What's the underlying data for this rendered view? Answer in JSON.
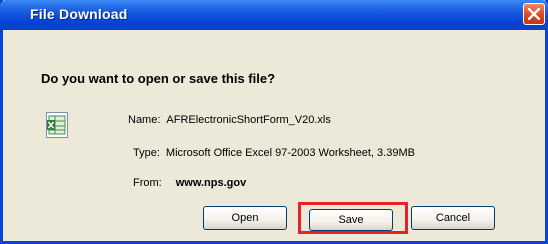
{
  "window": {
    "title": "File Download"
  },
  "dialog": {
    "question": "Do you want to open or save this file?",
    "file": {
      "name_label": "Name:",
      "name_value": "AFRElectronicShortForm_V20.xls",
      "type_label": "Type:",
      "type_value": "Microsoft Office Excel 97-2003 Worksheet, 3.39MB",
      "from_label": "From:",
      "from_value": "www.nps.gov"
    }
  },
  "buttons": {
    "open": "Open",
    "save": "Save",
    "cancel": "Cancel"
  },
  "icons": {
    "close": "close-icon",
    "file": "excel-file-icon"
  },
  "colors": {
    "highlight": "#e3232a",
    "titlebar": "#0844d6",
    "dialog_bg": "#ece9d8"
  }
}
